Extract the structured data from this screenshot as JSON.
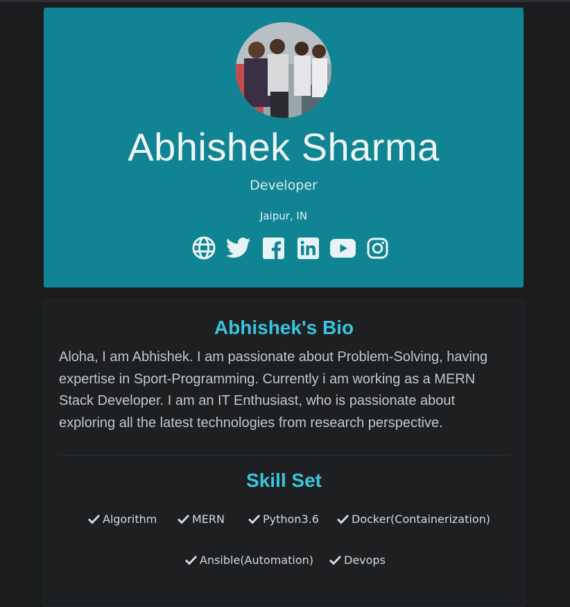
{
  "profile": {
    "name": "Abhishek Sharma",
    "role": "Developer",
    "location": "Jaipur, IN",
    "avatar_icon": "profile-photo"
  },
  "socials": [
    {
      "icon": "globe-icon"
    },
    {
      "icon": "twitter-icon"
    },
    {
      "icon": "facebook-icon"
    },
    {
      "icon": "linkedin-icon"
    },
    {
      "icon": "youtube-icon"
    },
    {
      "icon": "instagram-icon"
    }
  ],
  "bio": {
    "title": "Abhishek's Bio",
    "text": "Aloha, I am Abhishek. I am passionate about Problem-Solving, having expertise in Sport-Programming. Currently i am working as a MERN Stack Developer. I am an IT Enthusiast, who is passionate about exploring all the latest technologies from research perspective."
  },
  "skills": {
    "title": "Skill Set",
    "items": [
      "Algorithm",
      "MERN",
      "Python3.6",
      "Docker(Containerization)",
      "Ansible(Automation)",
      "Devops"
    ]
  },
  "colors": {
    "hero_bg": "#118494",
    "page_bg": "#1b1c1e",
    "accent": "#38c6de"
  }
}
